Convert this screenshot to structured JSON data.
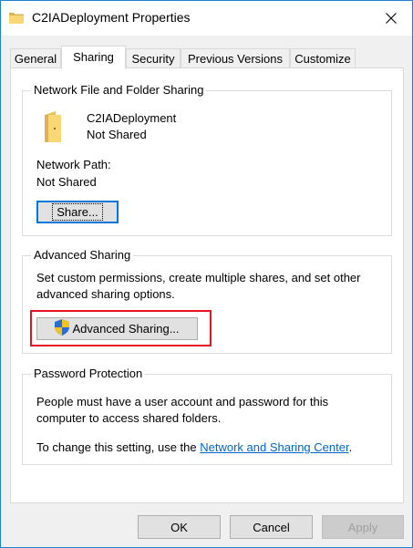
{
  "window": {
    "title": "C2IADeployment Properties"
  },
  "tabs": [
    {
      "label": "General",
      "active": false
    },
    {
      "label": "Sharing",
      "active": true
    },
    {
      "label": "Security",
      "active": false
    },
    {
      "label": "Previous Versions",
      "active": false
    },
    {
      "label": "Customize",
      "active": false
    }
  ],
  "network_sharing": {
    "group_title": "Network File and Folder Sharing",
    "folder_name": "C2IADeployment",
    "share_status": "Not Shared",
    "network_path_label": "Network Path:",
    "network_path_value": "Not Shared",
    "share_button": "Share..."
  },
  "advanced_sharing": {
    "group_title": "Advanced Sharing",
    "description_line1": "Set custom permissions, create multiple shares, and set other",
    "description_line2": "advanced sharing options.",
    "button": "Advanced Sharing...",
    "highlight_color": "#e81123"
  },
  "password_protection": {
    "group_title": "Password Protection",
    "description_line1": "People must have a user account and password for this",
    "description_line2": "computer to access shared folders.",
    "change_text": "To change this setting, use the",
    "link_text": "Network and Sharing Center",
    "link_suffix": "."
  },
  "footer": {
    "ok": "OK",
    "cancel": "Cancel",
    "apply": "Apply"
  },
  "icons": {
    "title": "folder-icon",
    "close": "close-icon",
    "folder": "folder-icon",
    "shield": "uac-shield-icon"
  }
}
